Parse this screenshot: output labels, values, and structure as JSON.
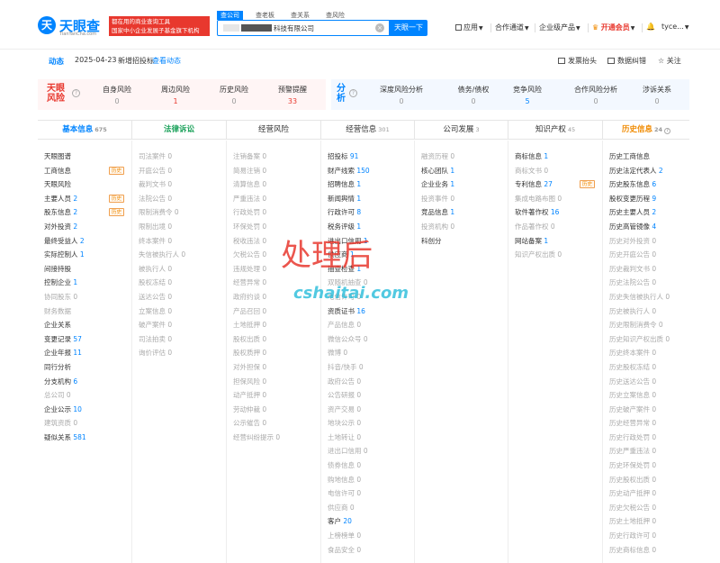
{
  "header": {
    "logo_mark": "天",
    "brand": "天眼查",
    "brand_url": "TianYanCha.com",
    "slogan_line1": "都在用的商业查询工具",
    "slogan_line2": "国家中小企业发展子基金旗下机构",
    "search_tabs": [
      "查公司",
      "查老板",
      "查关系",
      "查风险"
    ],
    "search_value": "科技有限公司",
    "search_button": "天眼一下",
    "nav": {
      "apps": "应用",
      "cooperation": "合作通道",
      "enterprise": "企业级产品",
      "vip": "开通会员",
      "user": "tyce..."
    }
  },
  "dynamics": {
    "label": "动态",
    "date": "2025-04-23",
    "text": "新增招投标",
    "link": "查看动态",
    "invoice": "发票抬头",
    "data_export": "数据纠错",
    "follow": "关注"
  },
  "risk": {
    "left_badge_1": "天眼",
    "left_badge_2": "风险",
    "left_items": [
      {
        "label": "自身风险",
        "value": "0"
      },
      {
        "label": "周边风险",
        "value": "1"
      },
      {
        "label": "历史风险",
        "value": "0"
      },
      {
        "label": "预警提醒",
        "value": "33"
      }
    ],
    "right_badge_1": "分",
    "right_badge_2": "析",
    "right_items": [
      {
        "label": "深度风险分析",
        "value": "0"
      },
      {
        "label": "债务/债权",
        "value": "0"
      },
      {
        "label": "竞争风险",
        "value": "5"
      },
      {
        "label": "合作风险分析",
        "value": "0"
      },
      {
        "label": "涉诉关系",
        "value": "0"
      }
    ]
  },
  "tabs": [
    {
      "label": "基本信息",
      "count": "675"
    },
    {
      "label": "法律诉讼",
      "count": ""
    },
    {
      "label": "经营风险",
      "count": ""
    },
    {
      "label": "经营信息",
      "count": "301"
    },
    {
      "label": "公司发展",
      "count": "3"
    },
    {
      "label": "知识产权",
      "count": "45"
    },
    {
      "label": "历史信息",
      "count": "24"
    }
  ],
  "columns": [
    [
      {
        "t": "天眼图谱",
        "n": ""
      },
      {
        "t": "工商信息",
        "n": "",
        "tag": "历史"
      },
      {
        "t": "天眼风险",
        "n": ""
      },
      {
        "t": "主要人员",
        "n": "2",
        "tag": "历史"
      },
      {
        "t": "股东信息",
        "n": "2",
        "tag": "历史"
      },
      {
        "t": "对外投资",
        "n": "2"
      },
      {
        "t": "最终受益人",
        "n": "2"
      },
      {
        "t": "实际控制人",
        "n": "1"
      },
      {
        "t": "间接持股",
        "n": ""
      },
      {
        "t": "控制企业",
        "n": "1"
      },
      {
        "t": "协同股东",
        "n": "0",
        "dim": true
      },
      {
        "t": "财务数据",
        "n": "",
        "dim": true
      },
      {
        "t": "企业关系",
        "n": ""
      },
      {
        "t": "变更记录",
        "n": "57"
      },
      {
        "t": "企业年报",
        "n": "11"
      },
      {
        "t": "同行分析",
        "n": ""
      },
      {
        "t": "分支机构",
        "n": "6"
      },
      {
        "t": "总公司",
        "n": "0",
        "dim": true
      },
      {
        "t": "企业公示",
        "n": "10"
      },
      {
        "t": "建筑资质",
        "n": "0",
        "dim": true
      },
      {
        "t": "疑似关系",
        "n": "581"
      }
    ],
    [
      {
        "t": "司法案件",
        "n": "0",
        "dim": true
      },
      {
        "t": "开庭公告",
        "n": "0",
        "dim": true
      },
      {
        "t": "裁判文书",
        "n": "0",
        "dim": true
      },
      {
        "t": "法院公告",
        "n": "0",
        "dim": true
      },
      {
        "t": "限制消费令",
        "n": "0",
        "dim": true
      },
      {
        "t": "限制出境",
        "n": "0",
        "dim": true
      },
      {
        "t": "终本案件",
        "n": "0",
        "dim": true
      },
      {
        "t": "失信被执行人",
        "n": "0",
        "dim": true
      },
      {
        "t": "被执行人",
        "n": "0",
        "dim": true
      },
      {
        "t": "股权冻结",
        "n": "0",
        "dim": true
      },
      {
        "t": "送达公告",
        "n": "0",
        "dim": true
      },
      {
        "t": "立案信息",
        "n": "0",
        "dim": true
      },
      {
        "t": "破产案件",
        "n": "0",
        "dim": true
      },
      {
        "t": "司法拍卖",
        "n": "0",
        "dim": true
      },
      {
        "t": "询价评估",
        "n": "0",
        "dim": true
      }
    ],
    [
      {
        "t": "注销备案",
        "n": "0",
        "dim": true
      },
      {
        "t": "简易注销",
        "n": "0",
        "dim": true
      },
      {
        "t": "清算信息",
        "n": "0",
        "dim": true
      },
      {
        "t": "严重违法",
        "n": "0",
        "dim": true
      },
      {
        "t": "行政处罚",
        "n": "0",
        "dim": true
      },
      {
        "t": "环保处罚",
        "n": "0",
        "dim": true
      },
      {
        "t": "税收违法",
        "n": "0",
        "dim": true
      },
      {
        "t": "欠税公告",
        "n": "0",
        "dim": true
      },
      {
        "t": "违规处理",
        "n": "0",
        "dim": true
      },
      {
        "t": "经营异常",
        "n": "0",
        "dim": true
      },
      {
        "t": "政府约谈",
        "n": "0",
        "dim": true
      },
      {
        "t": "产品召回",
        "n": "0",
        "dim": true
      },
      {
        "t": "土地抵押",
        "n": "0",
        "dim": true
      },
      {
        "t": "股权出质",
        "n": "0",
        "dim": true
      },
      {
        "t": "股权质押",
        "n": "0",
        "dim": true
      },
      {
        "t": "对外担保",
        "n": "0",
        "dim": true
      },
      {
        "t": "担保风险",
        "n": "0",
        "dim": true
      },
      {
        "t": "动产抵押",
        "n": "0",
        "dim": true
      },
      {
        "t": "劳动仲裁",
        "n": "0",
        "dim": true
      },
      {
        "t": "公示催告",
        "n": "0",
        "dim": true
      },
      {
        "t": "经营纠纷提示",
        "n": "0",
        "dim": true
      }
    ],
    [
      {
        "t": "招投标",
        "n": "91"
      },
      {
        "t": "财产线索",
        "n": "150"
      },
      {
        "t": "招聘信息",
        "n": "1"
      },
      {
        "t": "新闻舆情",
        "n": "1"
      },
      {
        "t": "行政许可",
        "n": "8"
      },
      {
        "t": "税务评级",
        "n": "1"
      },
      {
        "t": "进出口信用",
        "n": "1"
      },
      {
        "t": "供应商",
        "n": "1"
      },
      {
        "t": "抽查检查",
        "n": "1"
      },
      {
        "t": "双随机抽查",
        "n": "0",
        "dim": true
      },
      {
        "t": "电信许可",
        "n": "0",
        "dim": true
      },
      {
        "t": "资质证书",
        "n": "16"
      },
      {
        "t": "产品信息",
        "n": "0",
        "dim": true
      },
      {
        "t": "微信公众号",
        "n": "0",
        "dim": true
      },
      {
        "t": "微博",
        "n": "0",
        "dim": true
      },
      {
        "t": "抖音/快手",
        "n": "0",
        "dim": true
      },
      {
        "t": "政府公告",
        "n": "0",
        "dim": true
      },
      {
        "t": "公告研报",
        "n": "0",
        "dim": true
      },
      {
        "t": "资产交易",
        "n": "0",
        "dim": true
      },
      {
        "t": "地块公示",
        "n": "0",
        "dim": true
      },
      {
        "t": "土地转让",
        "n": "0",
        "dim": true
      },
      {
        "t": "进出口信用",
        "n": "0",
        "dim": true
      },
      {
        "t": "债券信息",
        "n": "0",
        "dim": true
      },
      {
        "t": "购地信息",
        "n": "0",
        "dim": true
      },
      {
        "t": "电信许可",
        "n": "0",
        "dim": true
      },
      {
        "t": "供应商",
        "n": "0",
        "dim": true
      },
      {
        "t": "客户",
        "n": "20"
      },
      {
        "t": "上榜榜单",
        "n": "0",
        "dim": true
      },
      {
        "t": "食品安全",
        "n": "0",
        "dim": true
      }
    ],
    [
      {
        "t": "融资历程",
        "n": "0",
        "dim": true
      },
      {
        "t": "核心团队",
        "n": "1"
      },
      {
        "t": "企业业务",
        "n": "1"
      },
      {
        "t": "投资事件",
        "n": "0",
        "dim": true
      },
      {
        "t": "竞品信息",
        "n": "1"
      },
      {
        "t": "投资机构",
        "n": "0",
        "dim": true
      },
      {
        "t": "科创分",
        "n": ""
      }
    ],
    [
      {
        "t": "商标信息",
        "n": "1"
      },
      {
        "t": "商标文书",
        "n": "0",
        "dim": true
      },
      {
        "t": "专利信息",
        "n": "27",
        "tag": "历史"
      },
      {
        "t": "集成电路布图",
        "n": "0",
        "dim": true
      },
      {
        "t": "软件著作权",
        "n": "16"
      },
      {
        "t": "作品著作权",
        "n": "0",
        "dim": true
      },
      {
        "t": "网站备案",
        "n": "1"
      },
      {
        "t": "知识产权出质",
        "n": "0",
        "dim": true
      }
    ],
    [
      {
        "t": "历史工商信息",
        "n": ""
      },
      {
        "t": "历史法定代表人",
        "n": "2"
      },
      {
        "t": "历史股东信息",
        "n": "6"
      },
      {
        "t": "股权变更历程",
        "n": "9"
      },
      {
        "t": "历史主要人员",
        "n": "2"
      },
      {
        "t": "历史高管镜像",
        "n": "4"
      },
      {
        "t": "历史对外投资",
        "n": "0",
        "dim": true
      },
      {
        "t": "历史开庭公告",
        "n": "0",
        "dim": true
      },
      {
        "t": "历史裁判文书",
        "n": "0",
        "dim": true
      },
      {
        "t": "历史法院公告",
        "n": "0",
        "dim": true
      },
      {
        "t": "历史失信被执行人",
        "n": "0",
        "dim": true
      },
      {
        "t": "历史被执行人",
        "n": "0",
        "dim": true
      },
      {
        "t": "历史限制消费令",
        "n": "0",
        "dim": true
      },
      {
        "t": "历史知识产权出质",
        "n": "0",
        "dim": true
      },
      {
        "t": "历史终本案件",
        "n": "0",
        "dim": true
      },
      {
        "t": "历史股权冻结",
        "n": "0",
        "dim": true
      },
      {
        "t": "历史送达公告",
        "n": "0",
        "dim": true
      },
      {
        "t": "历史立案信息",
        "n": "0",
        "dim": true
      },
      {
        "t": "历史破产案件",
        "n": "0",
        "dim": true
      },
      {
        "t": "历史经营异常",
        "n": "0",
        "dim": true
      },
      {
        "t": "历史行政处罚",
        "n": "0",
        "dim": true
      },
      {
        "t": "历史严重违法",
        "n": "0",
        "dim": true
      },
      {
        "t": "历史环保处罚",
        "n": "0",
        "dim": true
      },
      {
        "t": "历史股权出质",
        "n": "0",
        "dim": true
      },
      {
        "t": "历史动产抵押",
        "n": "0",
        "dim": true
      },
      {
        "t": "历史欠税公告",
        "n": "0",
        "dim": true
      },
      {
        "t": "历史土地抵押",
        "n": "0",
        "dim": true
      },
      {
        "t": "历史行政许可",
        "n": "0",
        "dim": true
      },
      {
        "t": "历史商标信息",
        "n": "0",
        "dim": true
      }
    ]
  ],
  "watermark": {
    "cn": "处理后",
    "site": "cshaitai.com"
  },
  "colors": {
    "accent": "#0084ff",
    "risk_red": "#e8382e",
    "law_green": "#18a058",
    "history_orange": "#f08a00"
  }
}
